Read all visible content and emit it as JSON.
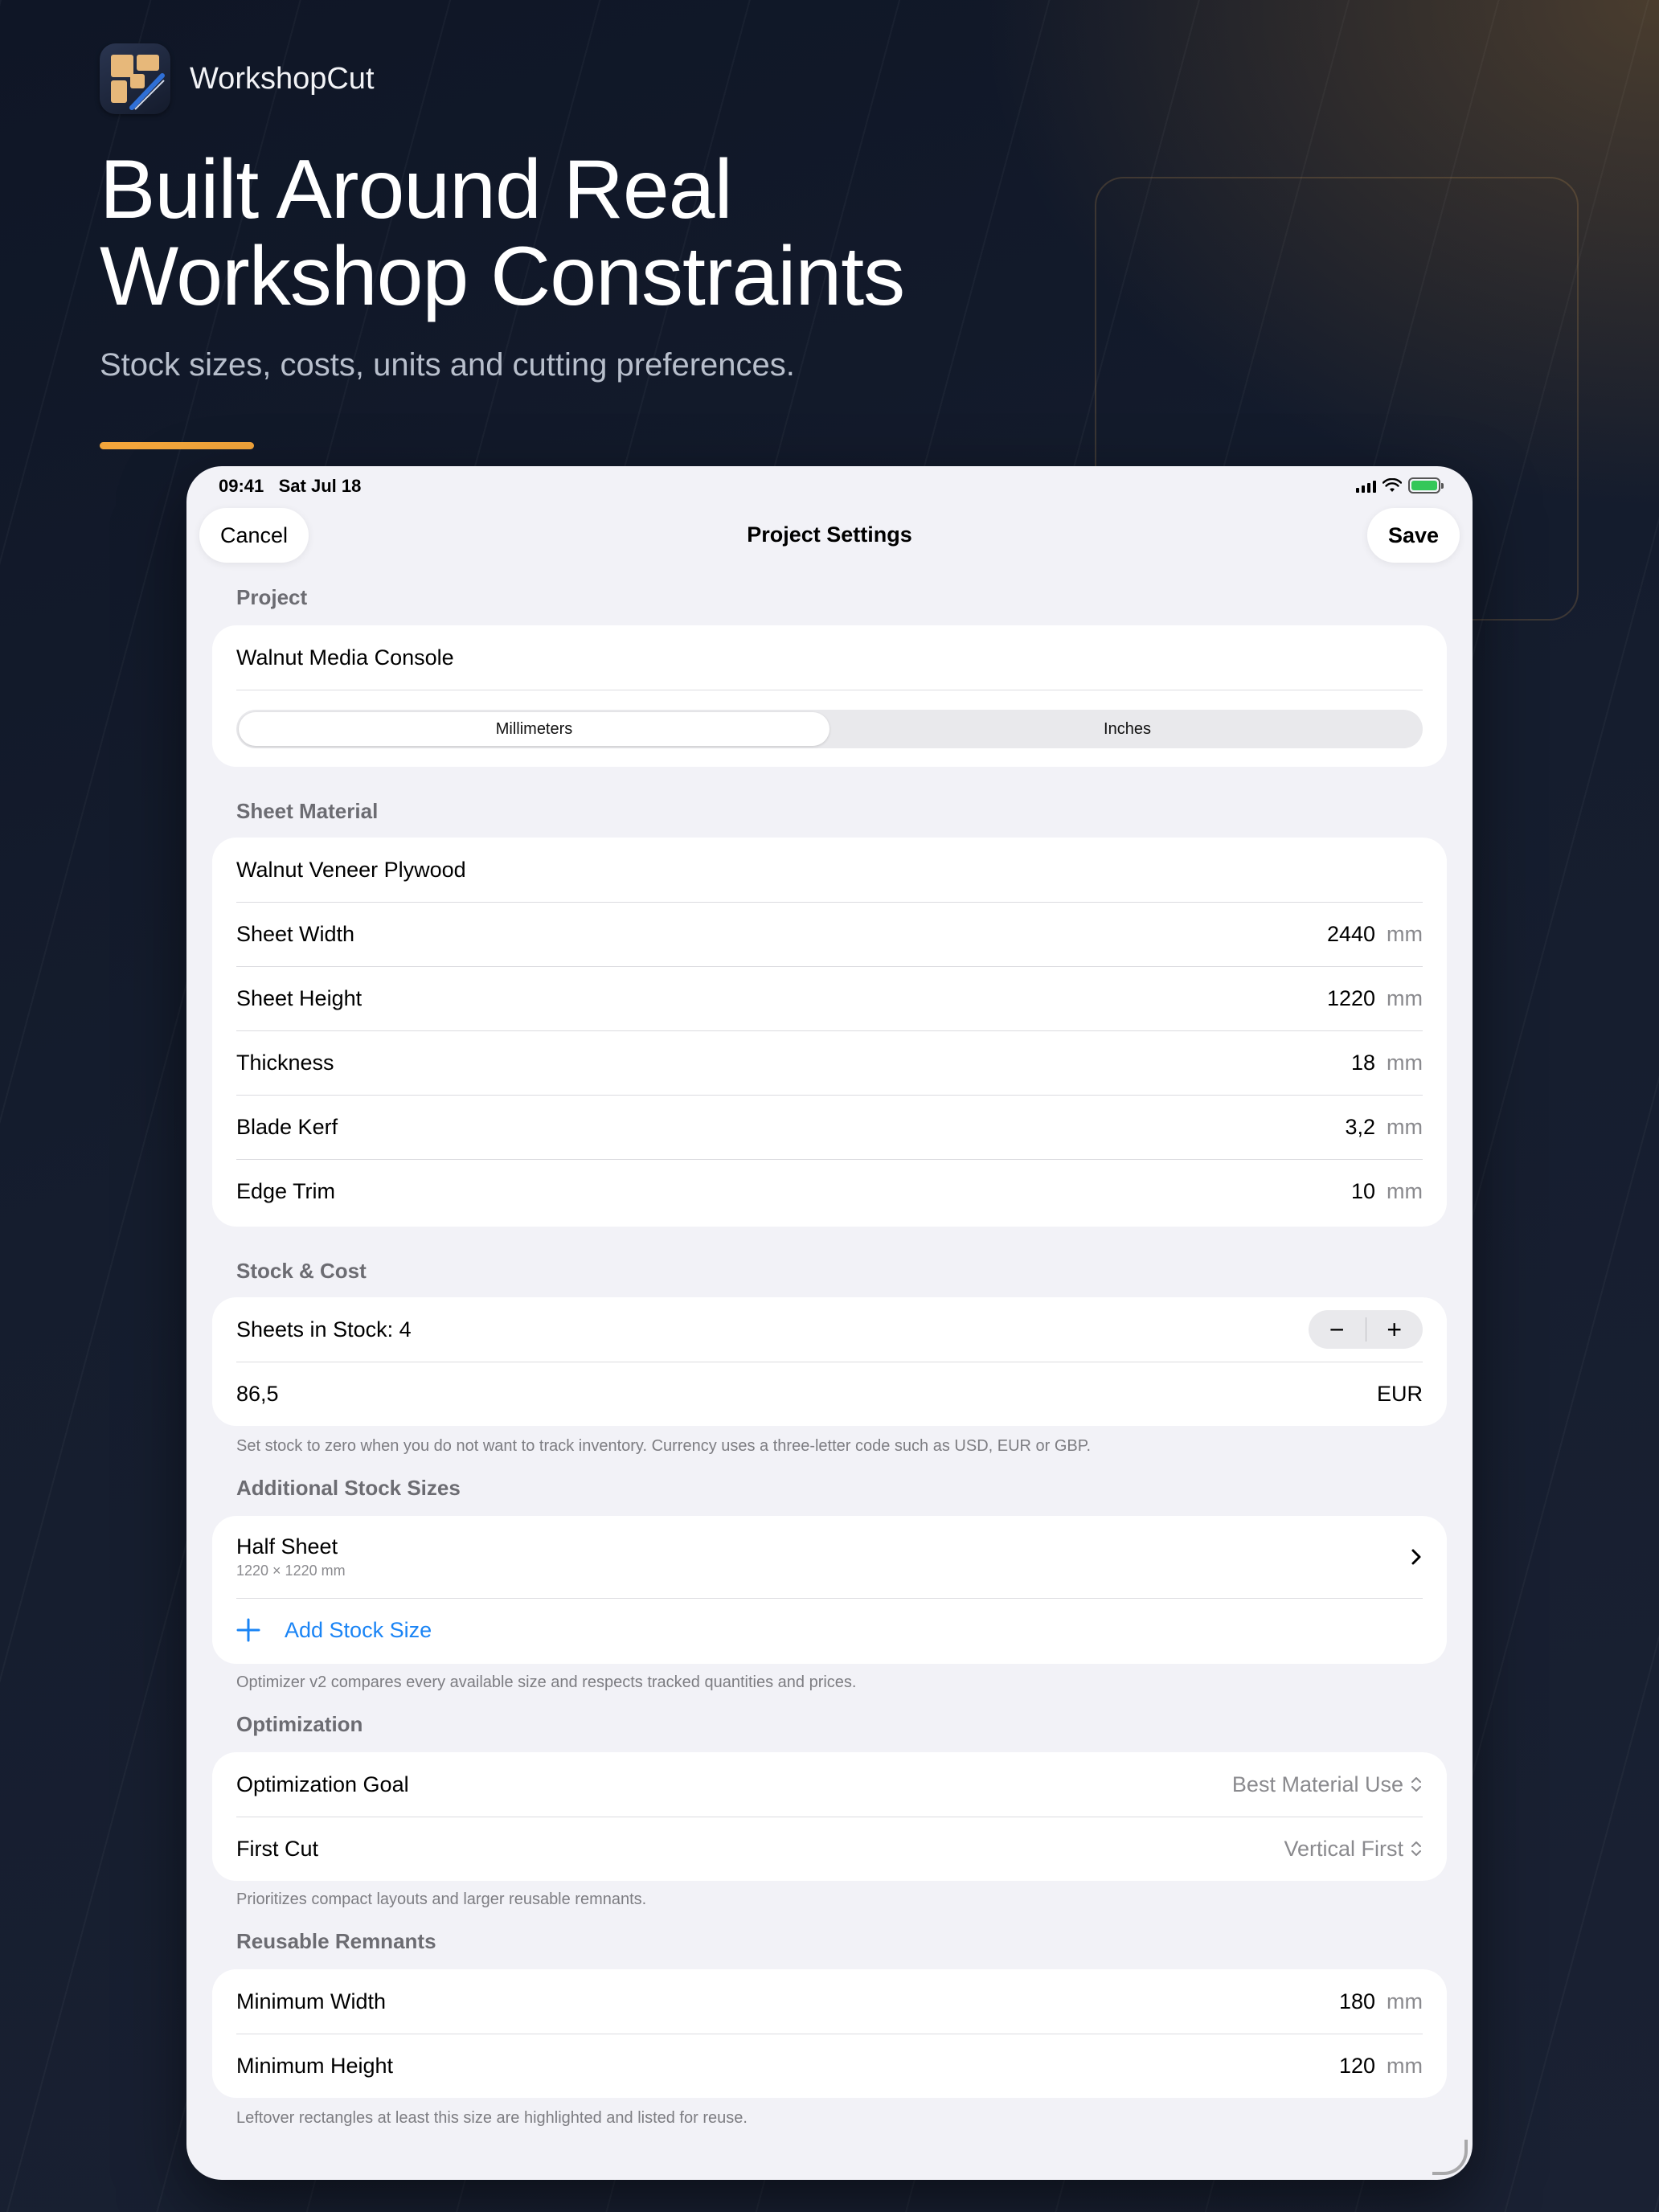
{
  "brand": {
    "name": "WorkshopCut",
    "icon": "app-icon"
  },
  "headline": {
    "line1": "Built Around Real",
    "line2": "Workshop Constraints"
  },
  "subhead": "Stock sizes, costs, units and cutting preferences.",
  "colors": {
    "accent": "#f3a53b",
    "link": "#1a84f5",
    "battery": "#34c759"
  },
  "status": {
    "time": "09:41",
    "date": "Sat Jul 18"
  },
  "nav": {
    "cancel": "Cancel",
    "title": "Project Settings",
    "save": "Save"
  },
  "project": {
    "section": "Project",
    "name": "Walnut Media Console",
    "units": [
      "Millimeters",
      "Inches"
    ],
    "selected_unit": "Millimeters"
  },
  "sheet": {
    "section": "Sheet Material",
    "material": "Walnut Veneer Plywood",
    "rows": [
      {
        "label": "Sheet Width",
        "value": "2440",
        "unit": "mm"
      },
      {
        "label": "Sheet Height",
        "value": "1220",
        "unit": "mm"
      },
      {
        "label": "Thickness",
        "value": "18",
        "unit": "mm"
      },
      {
        "label": "Blade Kerf",
        "value": "3,2",
        "unit": "mm"
      },
      {
        "label": "Edge Trim",
        "value": "10",
        "unit": "mm"
      }
    ]
  },
  "stock": {
    "section": "Stock & Cost",
    "sheets_label": "Sheets in Stock: 4",
    "minus": "−",
    "plus": "+",
    "price": "86,5",
    "currency": "EUR",
    "note": "Set stock to zero when you do not want to track inventory. Currency uses a three-letter code such as USD, EUR or GBP."
  },
  "additional": {
    "section": "Additional Stock Sizes",
    "item_title": "Half Sheet",
    "item_sub": "1220 × 1220 mm",
    "add_label": "Add Stock Size",
    "note": "Optimizer v2 compares every available size and respects tracked quantities and prices."
  },
  "optimization": {
    "section": "Optimization",
    "goal_label": "Optimization Goal",
    "goal_value": "Best Material Use",
    "firstcut_label": "First Cut",
    "firstcut_value": "Vertical First",
    "note": "Prioritizes compact layouts and larger reusable remnants."
  },
  "remnants": {
    "section": "Reusable Remnants",
    "rows": [
      {
        "label": "Minimum Width",
        "value": "180",
        "unit": "mm"
      },
      {
        "label": "Minimum Height",
        "value": "120",
        "unit": "mm"
      }
    ],
    "note": "Leftover rectangles at least this size are highlighted and listed for reuse."
  }
}
